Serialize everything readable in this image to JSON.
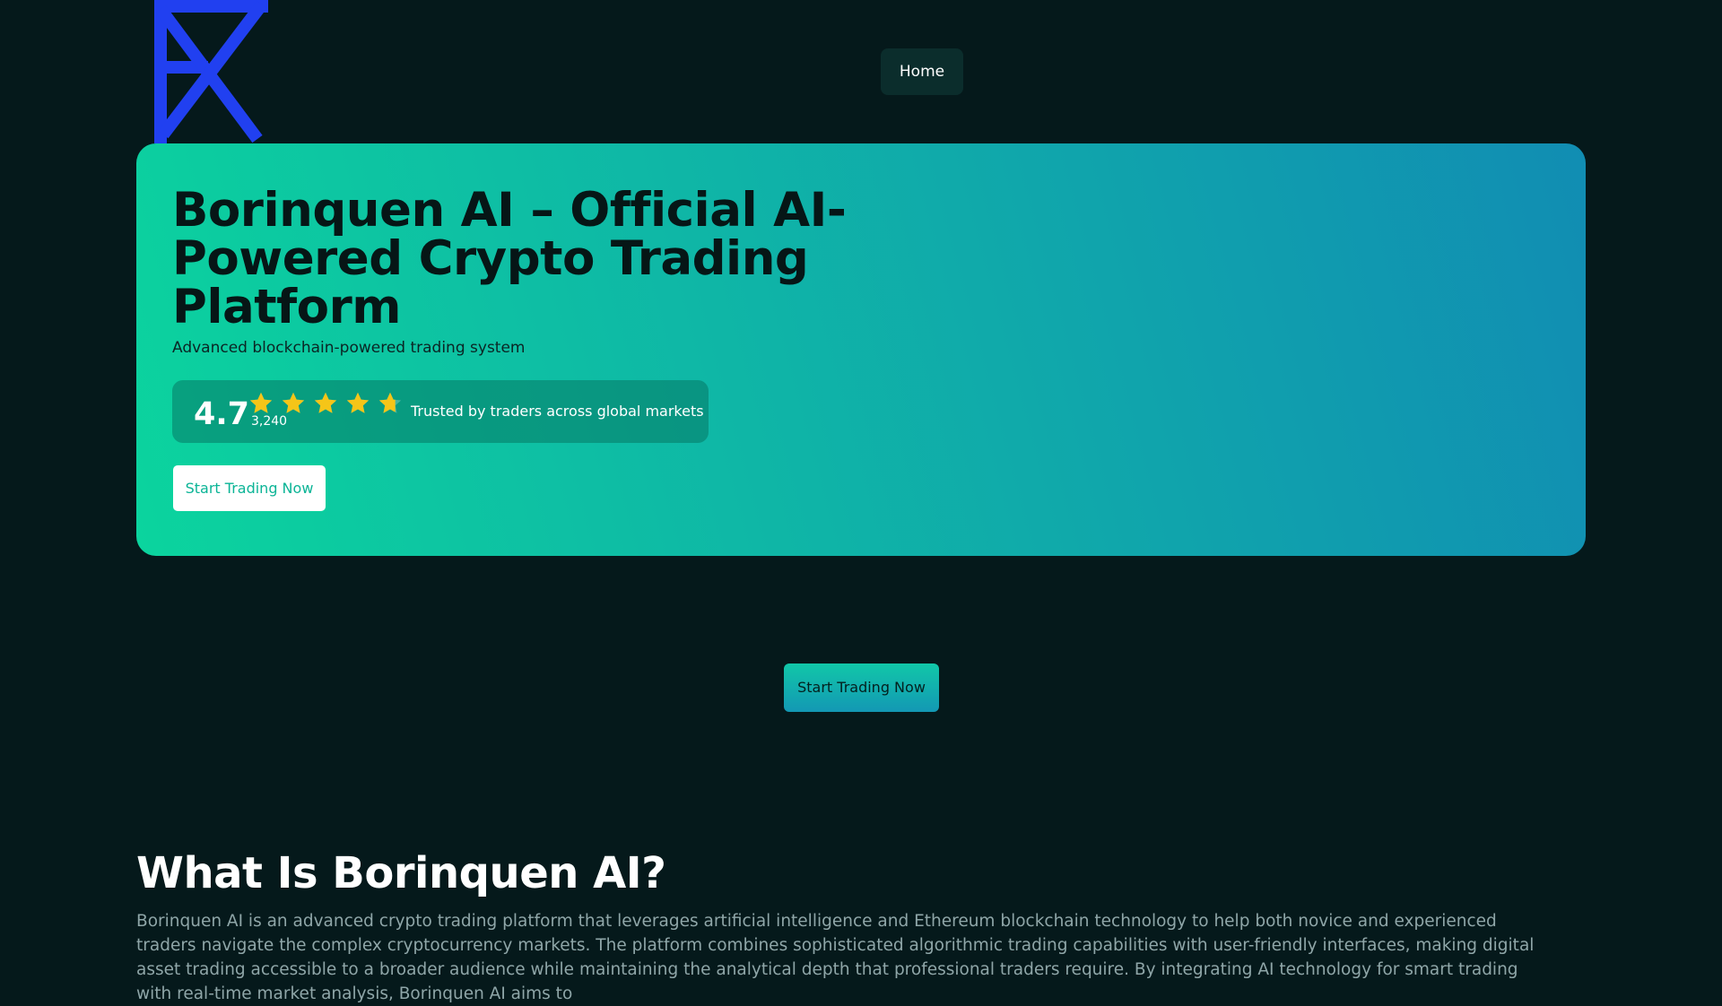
{
  "header": {
    "logo_name": "borinquen-logo",
    "nav": {
      "home_label": "Home"
    }
  },
  "hero": {
    "title": "Borinquen AI – Official AI-Powered Crypto Trading Platform",
    "subtitle": "Advanced blockchain-powered trading system",
    "rating": {
      "value": "4.7",
      "count": "3,240",
      "stars": 4.7,
      "star_color": "#f5c518",
      "trusted_text": "Trusted by traders across global markets"
    },
    "cta_label": "Start Trading Now"
  },
  "mid_cta": {
    "label": "Start Trading Now"
  },
  "about": {
    "title": "What Is Borinquen AI?",
    "body": "Borinquen AI is an advanced crypto trading platform that leverages artificial intelligence and Ethereum blockchain technology to help both novice and experienced traders navigate the complex cryptocurrency markets. The platform combines sophisticated algorithmic trading capabilities with user-friendly interfaces, making digital asset trading accessible to a broader audience while maintaining the analytical depth that professional traders require. By integrating AI technology for smart trading with real-time market analysis, Borinquen AI aims to"
  },
  "colors": {
    "background": "#05191b",
    "hero_gradient_start": "#0bd49e",
    "hero_gradient_end": "#118db3",
    "logo_blue": "#2140f0",
    "accent": "#0bd49e"
  }
}
